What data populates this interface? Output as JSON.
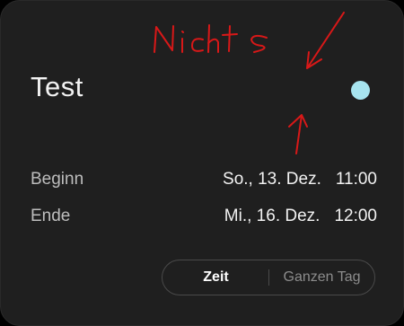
{
  "event": {
    "title": "Test",
    "color": "#a7e4ef"
  },
  "begin": {
    "label": "Beginn",
    "date": "So., 13. Dez.",
    "time": "11:00"
  },
  "end": {
    "label": "Ende",
    "date": "Mi., 16. Dez.",
    "time": "12:00"
  },
  "mode_toggle": {
    "time_label": "Zeit",
    "allday_label": "Ganzen Tag",
    "selected": "Zeit"
  },
  "annotation": {
    "text": "Nichts",
    "color": "#d81818"
  }
}
